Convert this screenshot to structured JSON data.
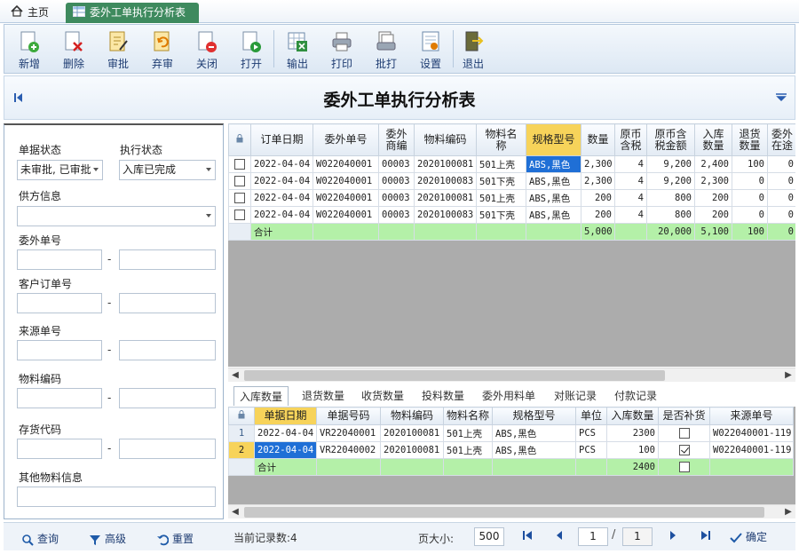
{
  "tabs": {
    "home": "主页",
    "active": "委外工单执行分析表"
  },
  "toolbar": [
    {
      "label": "新增",
      "icon": "new-icon"
    },
    {
      "label": "删除",
      "icon": "delete-icon"
    },
    {
      "label": "审批",
      "icon": "approve-icon"
    },
    {
      "label": "弃审",
      "icon": "unapprove-icon"
    },
    {
      "label": "关闭",
      "icon": "close-doc-icon"
    },
    {
      "label": "打开",
      "icon": "open-doc-icon"
    },
    {
      "label": "输出",
      "icon": "export-icon"
    },
    {
      "label": "打印",
      "icon": "print-icon"
    },
    {
      "label": "批打",
      "icon": "batch-print-icon"
    },
    {
      "label": "设置",
      "icon": "settings-icon"
    },
    {
      "label": "退出",
      "icon": "exit-icon"
    }
  ],
  "title": "委外工单执行分析表",
  "filters": {
    "doc_status_label": "单据状态",
    "doc_status_value": "未审批, 已审批",
    "exec_status_label": "执行状态",
    "exec_status_value": "入库已完成",
    "supplier_label": "供方信息",
    "supplier_value": "",
    "outsource_no_label": "委外单号",
    "customer_order_label": "客户订单号",
    "source_no_label": "来源单号",
    "material_code_label": "物料编码",
    "stock_code_label": "存货代码",
    "other_material_label": "其他物料信息",
    "range_sep": "-"
  },
  "main_grid": {
    "headers": [
      "订单日期",
      "委外单号",
      "委外\n商编",
      "物料编码",
      "物料名\n称",
      "规格型号",
      "数量",
      "原币\n含税",
      "原币含\n税金额",
      "入库\n数量",
      "退货\n数量",
      "委外\n在途"
    ],
    "rows": [
      [
        "2022-04-04",
        "W022040001",
        "00003",
        "2020100081",
        "501上壳",
        "ABS,黑色",
        "2,300",
        "4",
        "9,200",
        "2,400",
        "100",
        "0"
      ],
      [
        "2022-04-04",
        "W022040001",
        "00003",
        "2020100083",
        "501下壳",
        "ABS,黑色",
        "2,300",
        "4",
        "9,200",
        "2,300",
        "0",
        "0"
      ],
      [
        "2022-04-04",
        "W022040001",
        "00003",
        "2020100081",
        "501上壳",
        "ABS,黑色",
        "200",
        "4",
        "800",
        "200",
        "0",
        "0"
      ],
      [
        "2022-04-04",
        "W022040001",
        "00003",
        "2020100083",
        "501下壳",
        "ABS,黑色",
        "200",
        "4",
        "800",
        "200",
        "0",
        "0"
      ]
    ],
    "sum_label": "合计",
    "sum": {
      "qty": "5,000",
      "amount": "20,000",
      "in_qty": "5,100",
      "ret_qty": "100",
      "transit": "0"
    }
  },
  "sub_tabs": [
    "入库数量",
    "退货数量",
    "收货数量",
    "投料数量",
    "委外用料单",
    "对账记录",
    "付款记录"
  ],
  "sub_grid": {
    "headers": [
      "单据日期",
      "单据号码",
      "物料编码",
      "物料名称",
      "规格型号",
      "单位",
      "入库数量",
      "是否补货",
      "来源单号"
    ],
    "rows": [
      {
        "no": "1",
        "cells": [
          "2022-04-04",
          "VR22040001",
          "2020100081",
          "501上壳",
          "ABS,黑色",
          "PCS",
          "2300"
        ],
        "replenish": false,
        "source": "W022040001-119"
      },
      {
        "no": "2",
        "cells": [
          "2022-04-04",
          "VR22040002",
          "2020100081",
          "501上壳",
          "ABS,黑色",
          "PCS",
          "100"
        ],
        "replenish": true,
        "source": "W022040001-119"
      }
    ],
    "sum_label": "合计",
    "sum_qty": "2400"
  },
  "bottom": {
    "query": "查询",
    "advanced": "高级",
    "reset": "重置",
    "record_count": "当前记录数:4",
    "page_size_label": "页大小:",
    "page_size": "500",
    "page_current": "1",
    "page_total": "1",
    "confirm": "确定"
  },
  "colors": {
    "accent": "#3e8a5e",
    "highlight": "#f7d35a",
    "sum": "#b4f0a8",
    "selected": "#1f6fd6"
  }
}
